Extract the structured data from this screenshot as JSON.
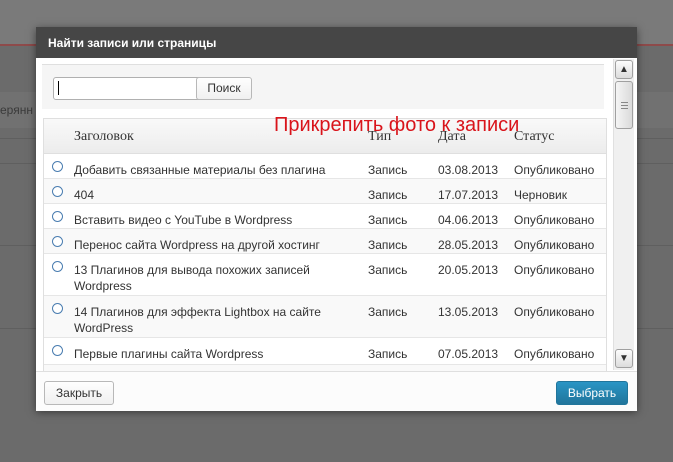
{
  "background": {
    "partial_text": "ерянн"
  },
  "dialog": {
    "title": "Найти записи или страницы",
    "search": {
      "value": "",
      "placeholder": "",
      "button_label": "Поиск"
    },
    "overlay_note": "Прикрепить фото к записи",
    "table": {
      "columns": {
        "title": "Заголовок",
        "type": "Тип",
        "date": "Дата",
        "status": "Статус"
      },
      "rows": [
        {
          "title": "Добавить связанные материалы без плагина",
          "type": "Запись",
          "date": "03.08.2013",
          "status": "Опубликовано"
        },
        {
          "title": "404",
          "type": "Запись",
          "date": "17.07.2013",
          "status": "Черновик"
        },
        {
          "title": "Вставить видео с YouTube в Wordpress",
          "type": "Запись",
          "date": "04.06.2013",
          "status": "Опубликовано"
        },
        {
          "title": "Перенос сайта Wordpress на другой хостинг",
          "type": "Запись",
          "date": "28.05.2013",
          "status": "Опубликовано"
        },
        {
          "title": "13 Плагинов для вывода похожих записей Wordpress",
          "type": "Запись",
          "date": "20.05.2013",
          "status": "Опубликовано"
        },
        {
          "title": "14 Плагинов для эффекта Lightbox на сайте WordPress",
          "type": "Запись",
          "date": "13.05.2013",
          "status": "Опубликовано"
        },
        {
          "title": "Первые плагины сайта Wordpress",
          "type": "Запись",
          "date": "07.05.2013",
          "status": "Опубликовано"
        }
      ]
    },
    "footer": {
      "close_label": "Закрыть",
      "select_label": "Выбрать"
    }
  },
  "colors": {
    "header_bg": "#464646",
    "accent_red": "#d9141b",
    "primary_button": "#21759b",
    "radio_border": "#4a7db0"
  },
  "icons": {
    "scroll_up": "chevron-up-icon",
    "scroll_down": "chevron-down-icon"
  }
}
